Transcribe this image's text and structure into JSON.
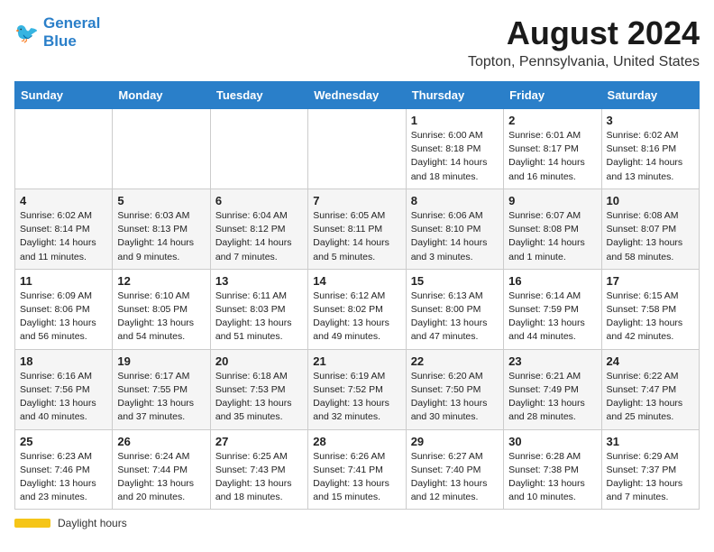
{
  "header": {
    "logo_line1": "General",
    "logo_line2": "Blue",
    "month_title": "August 2024",
    "location": "Topton, Pennsylvania, United States"
  },
  "weekdays": [
    "Sunday",
    "Monday",
    "Tuesday",
    "Wednesday",
    "Thursday",
    "Friday",
    "Saturday"
  ],
  "weeks": [
    [
      {
        "day": "",
        "info": ""
      },
      {
        "day": "",
        "info": ""
      },
      {
        "day": "",
        "info": ""
      },
      {
        "day": "",
        "info": ""
      },
      {
        "day": "1",
        "info": "Sunrise: 6:00 AM\nSunset: 8:18 PM\nDaylight: 14 hours\nand 18 minutes."
      },
      {
        "day": "2",
        "info": "Sunrise: 6:01 AM\nSunset: 8:17 PM\nDaylight: 14 hours\nand 16 minutes."
      },
      {
        "day": "3",
        "info": "Sunrise: 6:02 AM\nSunset: 8:16 PM\nDaylight: 14 hours\nand 13 minutes."
      }
    ],
    [
      {
        "day": "4",
        "info": "Sunrise: 6:02 AM\nSunset: 8:14 PM\nDaylight: 14 hours\nand 11 minutes."
      },
      {
        "day": "5",
        "info": "Sunrise: 6:03 AM\nSunset: 8:13 PM\nDaylight: 14 hours\nand 9 minutes."
      },
      {
        "day": "6",
        "info": "Sunrise: 6:04 AM\nSunset: 8:12 PM\nDaylight: 14 hours\nand 7 minutes."
      },
      {
        "day": "7",
        "info": "Sunrise: 6:05 AM\nSunset: 8:11 PM\nDaylight: 14 hours\nand 5 minutes."
      },
      {
        "day": "8",
        "info": "Sunrise: 6:06 AM\nSunset: 8:10 PM\nDaylight: 14 hours\nand 3 minutes."
      },
      {
        "day": "9",
        "info": "Sunrise: 6:07 AM\nSunset: 8:08 PM\nDaylight: 14 hours\nand 1 minute."
      },
      {
        "day": "10",
        "info": "Sunrise: 6:08 AM\nSunset: 8:07 PM\nDaylight: 13 hours\nand 58 minutes."
      }
    ],
    [
      {
        "day": "11",
        "info": "Sunrise: 6:09 AM\nSunset: 8:06 PM\nDaylight: 13 hours\nand 56 minutes."
      },
      {
        "day": "12",
        "info": "Sunrise: 6:10 AM\nSunset: 8:05 PM\nDaylight: 13 hours\nand 54 minutes."
      },
      {
        "day": "13",
        "info": "Sunrise: 6:11 AM\nSunset: 8:03 PM\nDaylight: 13 hours\nand 51 minutes."
      },
      {
        "day": "14",
        "info": "Sunrise: 6:12 AM\nSunset: 8:02 PM\nDaylight: 13 hours\nand 49 minutes."
      },
      {
        "day": "15",
        "info": "Sunrise: 6:13 AM\nSunset: 8:00 PM\nDaylight: 13 hours\nand 47 minutes."
      },
      {
        "day": "16",
        "info": "Sunrise: 6:14 AM\nSunset: 7:59 PM\nDaylight: 13 hours\nand 44 minutes."
      },
      {
        "day": "17",
        "info": "Sunrise: 6:15 AM\nSunset: 7:58 PM\nDaylight: 13 hours\nand 42 minutes."
      }
    ],
    [
      {
        "day": "18",
        "info": "Sunrise: 6:16 AM\nSunset: 7:56 PM\nDaylight: 13 hours\nand 40 minutes."
      },
      {
        "day": "19",
        "info": "Sunrise: 6:17 AM\nSunset: 7:55 PM\nDaylight: 13 hours\nand 37 minutes."
      },
      {
        "day": "20",
        "info": "Sunrise: 6:18 AM\nSunset: 7:53 PM\nDaylight: 13 hours\nand 35 minutes."
      },
      {
        "day": "21",
        "info": "Sunrise: 6:19 AM\nSunset: 7:52 PM\nDaylight: 13 hours\nand 32 minutes."
      },
      {
        "day": "22",
        "info": "Sunrise: 6:20 AM\nSunset: 7:50 PM\nDaylight: 13 hours\nand 30 minutes."
      },
      {
        "day": "23",
        "info": "Sunrise: 6:21 AM\nSunset: 7:49 PM\nDaylight: 13 hours\nand 28 minutes."
      },
      {
        "day": "24",
        "info": "Sunrise: 6:22 AM\nSunset: 7:47 PM\nDaylight: 13 hours\nand 25 minutes."
      }
    ],
    [
      {
        "day": "25",
        "info": "Sunrise: 6:23 AM\nSunset: 7:46 PM\nDaylight: 13 hours\nand 23 minutes."
      },
      {
        "day": "26",
        "info": "Sunrise: 6:24 AM\nSunset: 7:44 PM\nDaylight: 13 hours\nand 20 minutes."
      },
      {
        "day": "27",
        "info": "Sunrise: 6:25 AM\nSunset: 7:43 PM\nDaylight: 13 hours\nand 18 minutes."
      },
      {
        "day": "28",
        "info": "Sunrise: 6:26 AM\nSunset: 7:41 PM\nDaylight: 13 hours\nand 15 minutes."
      },
      {
        "day": "29",
        "info": "Sunrise: 6:27 AM\nSunset: 7:40 PM\nDaylight: 13 hours\nand 12 minutes."
      },
      {
        "day": "30",
        "info": "Sunrise: 6:28 AM\nSunset: 7:38 PM\nDaylight: 13 hours\nand 10 minutes."
      },
      {
        "day": "31",
        "info": "Sunrise: 6:29 AM\nSunset: 7:37 PM\nDaylight: 13 hours\nand 7 minutes."
      }
    ]
  ],
  "footer": {
    "daylight_label": "Daylight hours"
  }
}
